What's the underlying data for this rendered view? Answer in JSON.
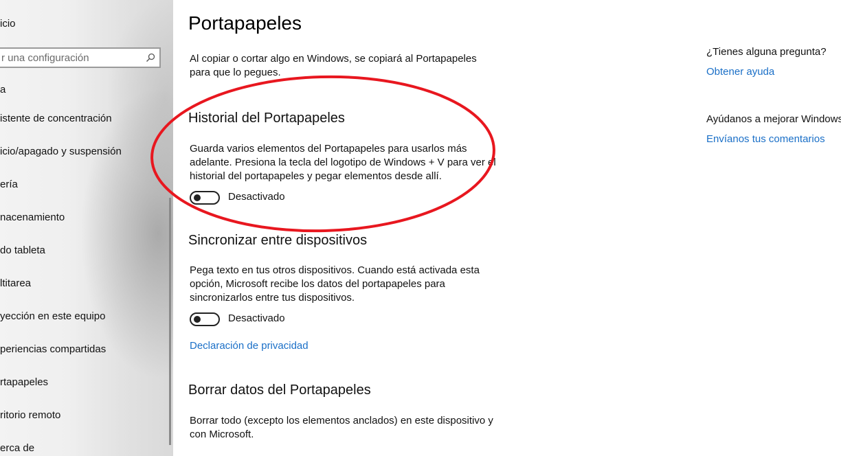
{
  "sidebar": {
    "home_label": "icio",
    "search_placeholder": "r una configuración",
    "section_mark": "a",
    "items": [
      {
        "label": "istente de concentración"
      },
      {
        "label": "icio/apagado y suspensión"
      },
      {
        "label": "ería"
      },
      {
        "label": "nacenamiento"
      },
      {
        "label": "do tableta"
      },
      {
        "label": "ltitarea"
      },
      {
        "label": "yección en este equipo"
      },
      {
        "label": "periencias compartidas"
      },
      {
        "label": "rtapapeles"
      },
      {
        "label": "ritorio remoto"
      },
      {
        "label": "erca de"
      }
    ]
  },
  "main": {
    "title": "Portapapeles",
    "intro": "Al copiar o cortar algo en Windows, se copiará al Portapapeles para que lo pegues.",
    "history": {
      "title": "Historial del Portapapeles",
      "description": "Guarda varios elementos del Portapapeles para usarlos más adelante. Presiona la tecla del logotipo de Windows + V para ver el historial del portapapeles y pegar elementos desde allí.",
      "toggle_state": "Desactivado"
    },
    "sync": {
      "title": "Sincronizar entre dispositivos",
      "description": "Pega texto en tus otros dispositivos. Cuando está activada esta opción, Microsoft recibe los datos del portapapeles para sincronizarlos entre tus dispositivos.",
      "toggle_state": "Desactivado",
      "privacy_link": "Declaración de privacidad"
    },
    "clear": {
      "title": "Borrar datos del Portapapeles",
      "description": "Borrar todo (excepto los elementos anclados) en este dispositivo y con Microsoft."
    }
  },
  "aside": {
    "question": "¿Tienes alguna pregunta?",
    "help_link": "Obtener ayuda",
    "improve": "Ayúdanos a mejorar Windows",
    "feedback_link": "Envíanos tus comentarios"
  },
  "colors": {
    "link": "#1a6fc7",
    "annotation": "#e8171f"
  }
}
